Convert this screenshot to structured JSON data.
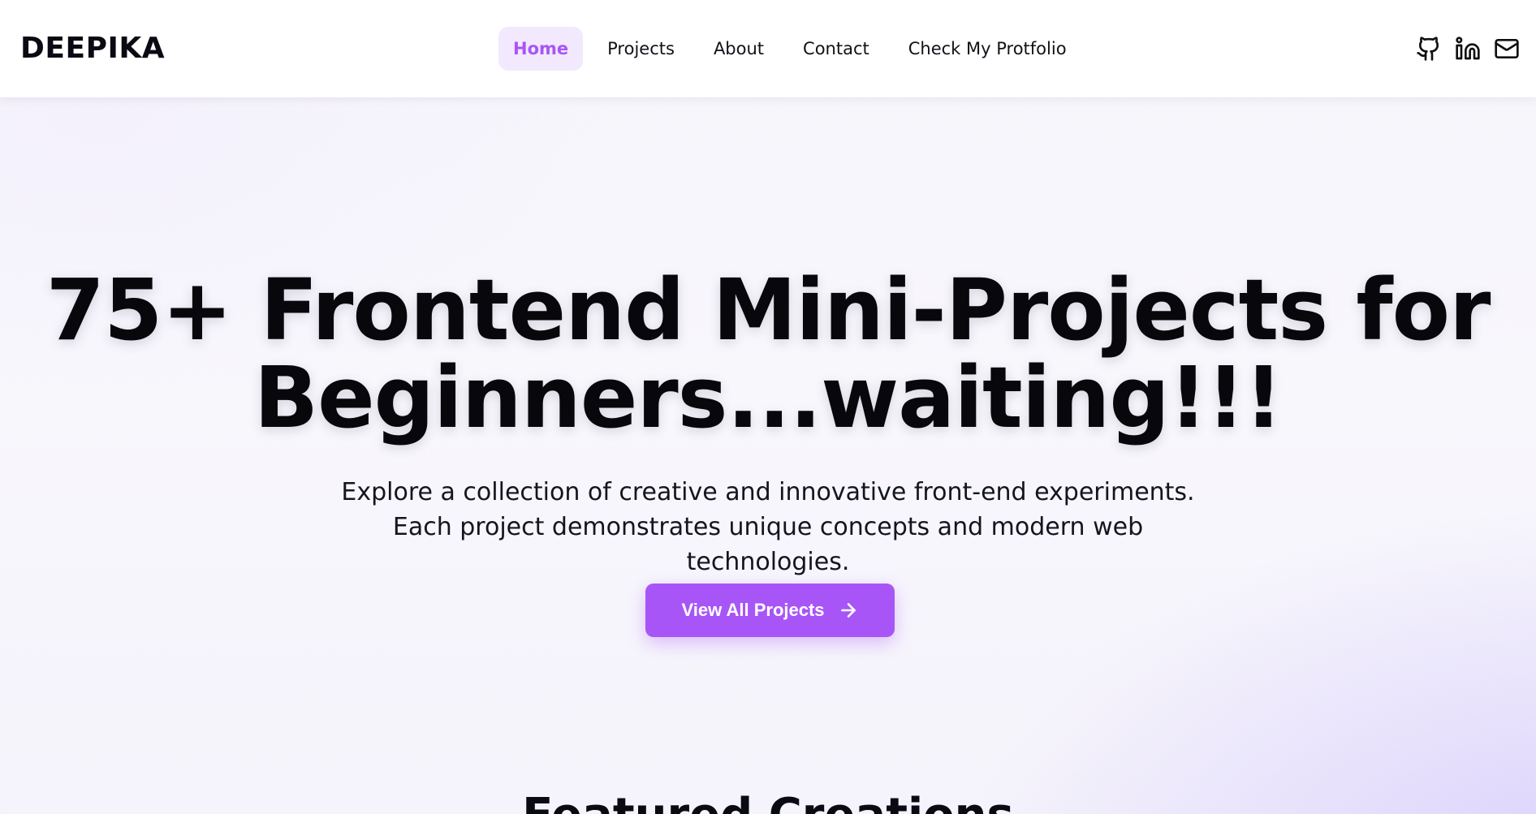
{
  "brand": {
    "name": "DEEPIKA"
  },
  "nav": {
    "items": [
      {
        "label": "Home",
        "active": true
      },
      {
        "label": "Projects",
        "active": false
      },
      {
        "label": "About",
        "active": false
      },
      {
        "label": "Contact",
        "active": false
      },
      {
        "label": "Check My Protfolio",
        "active": false
      }
    ]
  },
  "socials": [
    {
      "icon": "github-icon"
    },
    {
      "icon": "linkedin-icon"
    },
    {
      "icon": "mail-icon"
    }
  ],
  "hero": {
    "title": "75+ Frontend Mini-Projects for Beginners...waiting!!!",
    "subtitle": "Explore a collection of creative and innovative front-end experiments. Each project demonstrates unique concepts and modern web technologies.",
    "cta_label": "View All Projects",
    "cta_icon": "arrow-right-icon"
  },
  "featured": {
    "title": "Featured Creations"
  },
  "colors": {
    "accent": "#a855f7",
    "accent_soft": "#f2e9fe",
    "text": "#0a0a12"
  }
}
